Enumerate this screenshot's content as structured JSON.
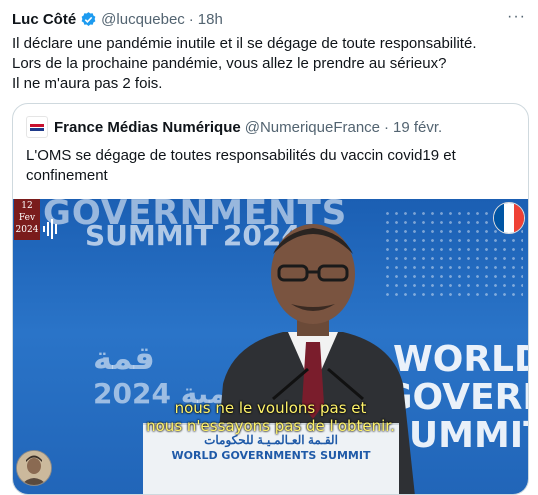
{
  "tweet": {
    "name": "Luc Côté",
    "handle": "@lucquebec",
    "dot": "·",
    "time": "18h",
    "more": "···",
    "lines": [
      "Il déclare une pandémie inutile et il se dégage de toute responsabilité.",
      "Lors de la prochaine pandémie, vous allez le prendre au sérieux?",
      "Il ne m'aura pas 2 fois."
    ]
  },
  "quote": {
    "avatar_label": "FRANCE MÉDIAS",
    "name": "France Médias Numérique",
    "handle": "@NumeriqueFrance",
    "dot": "·",
    "time": "19 févr.",
    "text": "L'OMS se dégage de toutes responsabilités du vaccin covid19 et confinement"
  },
  "video": {
    "date_day": "12",
    "date_month": "Fev",
    "date_year": "2024",
    "bg_left_1": "GOVERNMENTS",
    "bg_left_2": "SUMMIT 2024",
    "bg_left_3": "قمة",
    "bg_left_4": "2024 العالمية",
    "bg_right_1": "WORLD",
    "bg_right_2": "GOVERNMENTS",
    "bg_right_3": "SUMMIT",
    "podium_ar": "القـمة العـالمـيـة للحكومات",
    "podium_en": "WORLD GOVERNMENTS SUMMIT",
    "subtitle_1": "nous ne le voulons pas et",
    "subtitle_2": "nous n'essayons pas de l'obtenir.",
    "flag_colors": [
      "#0055a4",
      "#ffffff",
      "#ef4135"
    ]
  },
  "colors": {
    "text": "#0f1419",
    "secondary": "#536471",
    "verified": "#1d9bf0",
    "border": "#cfd9de"
  }
}
